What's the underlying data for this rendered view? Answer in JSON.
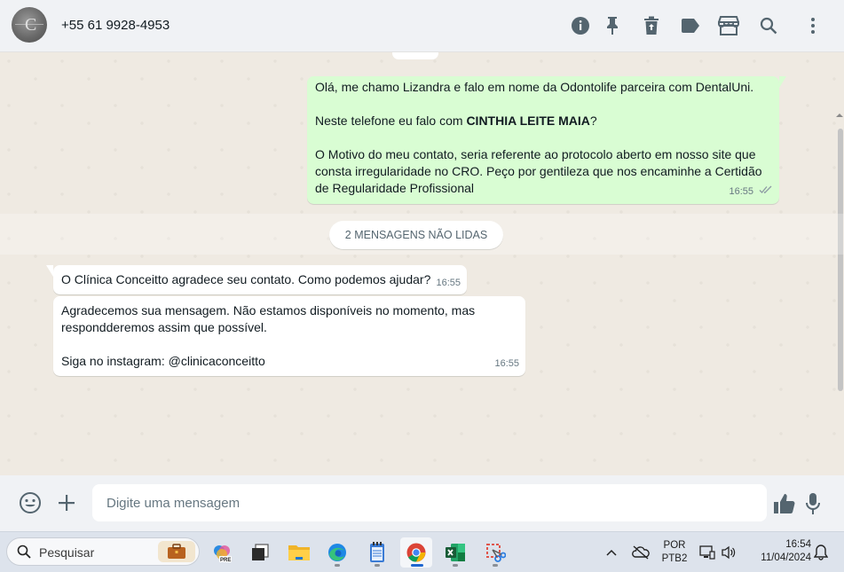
{
  "header": {
    "contact_name": "+55 61 9928-4953",
    "icons": [
      "info-icon",
      "pin-icon",
      "delete-icon",
      "label-icon",
      "store-icon",
      "search-icon",
      "menu-icon"
    ]
  },
  "messages": {
    "outgoing": {
      "line1": "Olá, me chamo Lizandra e falo em nome da Odontolife parceira com DentalUni.",
      "line2_prefix": "Neste telefone eu falo com ",
      "line2_bold": "CINTHIA LEITE MAIA",
      "line2_suffix": "?",
      "line3": "O Motivo do meu contato, seria referente ao protocolo aberto em nosso site que consta irregularidade no CRO. Peço por gentileza que nos encaminhe a Certidão de Regularidade Profissional",
      "time": "16:55",
      "status": "read-double-check"
    },
    "unread_label": "2 MENSAGENS NÃO LIDAS",
    "incoming": [
      {
        "text": "O Clínica Conceitto agradece seu contato. Como podemos ajudar?",
        "time": "16:55"
      },
      {
        "line1": "Agradecemos sua mensagem. Não estamos disponíveis no momento, mas respondderemos assim que possível.",
        "line2": "Siga no instagram: @clinicaconceitto",
        "time": "16:55"
      }
    ]
  },
  "composer": {
    "placeholder": "Digite uma mensagem",
    "icons": [
      "emoji-icon",
      "plus-icon",
      "thumbs-up-icon",
      "microphone-icon"
    ]
  },
  "taskbar": {
    "search_label": "Pesquisar",
    "apps": [
      "briefcase-icon",
      "copilot-icon",
      "task-view-icon",
      "file-explorer-icon",
      "edge-icon",
      "notepad-icon",
      "chrome-icon",
      "excel-icon",
      "snipping-tool-icon"
    ],
    "language": "POR",
    "keyboard": "PTB2",
    "time": "16:54",
    "date": "11/04/2024",
    "colors": {
      "accent": "#1e66d0",
      "bubble_out": "#d9fdd3",
      "bubble_in": "#ffffff",
      "chat_bg": "#efeae2"
    }
  }
}
